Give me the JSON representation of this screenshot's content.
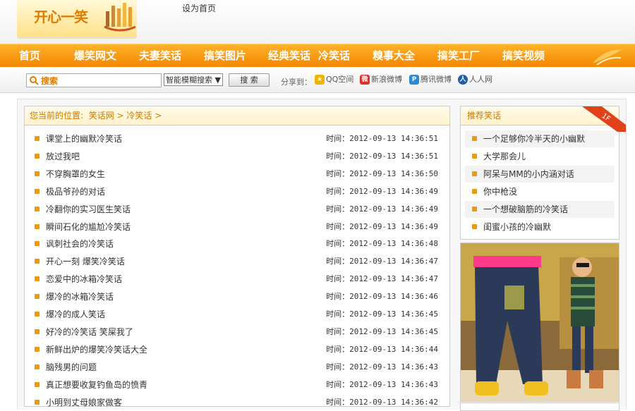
{
  "header": {
    "logo_text": "开心一笑",
    "set_home": "设为首页"
  },
  "nav": [
    "首页",
    "爆笑网文",
    "夫妻笑话",
    "搞笑图片",
    "经典笑话",
    "冷笑话",
    "糗事大全",
    "搞笑工厂",
    "搞笑视频"
  ],
  "search": {
    "placeholder": "搜索",
    "mode": "智能模糊搜索 ▼",
    "button": "搜 索"
  },
  "share": {
    "label": "分享到：",
    "items": [
      "QQ空间",
      "新浪微博",
      "腾讯微博",
      "人人网"
    ]
  },
  "breadcrumb": {
    "prefix": "您当前的位置:",
    "home": "笑话网",
    "sep1": ">",
    "section": "冷笑话",
    "sep2": ">"
  },
  "list": [
    {
      "title": "课堂上的幽默冷笑话",
      "time": "时间：2012-09-13 14:36:51"
    },
    {
      "title": "放过我吧",
      "time": "时间：2012-09-13 14:36:51"
    },
    {
      "title": "不穿胸罩的女生",
      "time": "时间：2012-09-13 14:36:50"
    },
    {
      "title": "极品爷孙的对话",
      "time": "时间：2012-09-13 14:36:49"
    },
    {
      "title": "冷翻你的实习医生笑话",
      "time": "时间：2012-09-13 14:36:49"
    },
    {
      "title": "瞬间石化的尴尬冷笑话",
      "time": "时间：2012-09-13 14:36:49"
    },
    {
      "title": "讽刺社会的冷笑话",
      "time": "时间：2012-09-13 14:36:48"
    },
    {
      "title": "开心一刻 爆笑冷笑话",
      "time": "时间：2012-09-13 14:36:47"
    },
    {
      "title": "恋爱中的冰箱冷笑话",
      "time": "时间：2012-09-13 14:36:47"
    },
    {
      "title": "爆冷的冰箱冷笑话",
      "time": "时间：2012-09-13 14:36:46"
    },
    {
      "title": "爆冷的成人笑话",
      "time": "时间：2012-09-13 14:36:45"
    },
    {
      "title": "好冷的冷笑话 笑屎我了",
      "time": "时间：2012-09-13 14:36:45"
    },
    {
      "title": "新鲜出炉的爆笑冷笑话大全",
      "time": "时间：2012-09-13 14:36:44"
    },
    {
      "title": "脑残男的问题",
      "time": "时间：2012-09-13 14:36:43"
    },
    {
      "title": "真正想要收复钓鱼岛的愤青",
      "time": "时间：2012-09-13 14:36:43"
    },
    {
      "title": "小明到丈母娘家做客",
      "time": "时间：2012-09-13 14:36:42"
    }
  ],
  "recommend": {
    "title": "推荐笑话",
    "badge": "1F",
    "items": [
      "一个足够你冷半天的小幽默",
      "大学那会儿",
      "阿呆与MM的小内涵对话",
      "你中枪没",
      "一个想破脑筋的冷笑话",
      "闺蜜小孩的冷幽默"
    ]
  },
  "colors": {
    "accent": "#f39800",
    "nav_bg": "#f28500",
    "link": "#cc7a00"
  }
}
